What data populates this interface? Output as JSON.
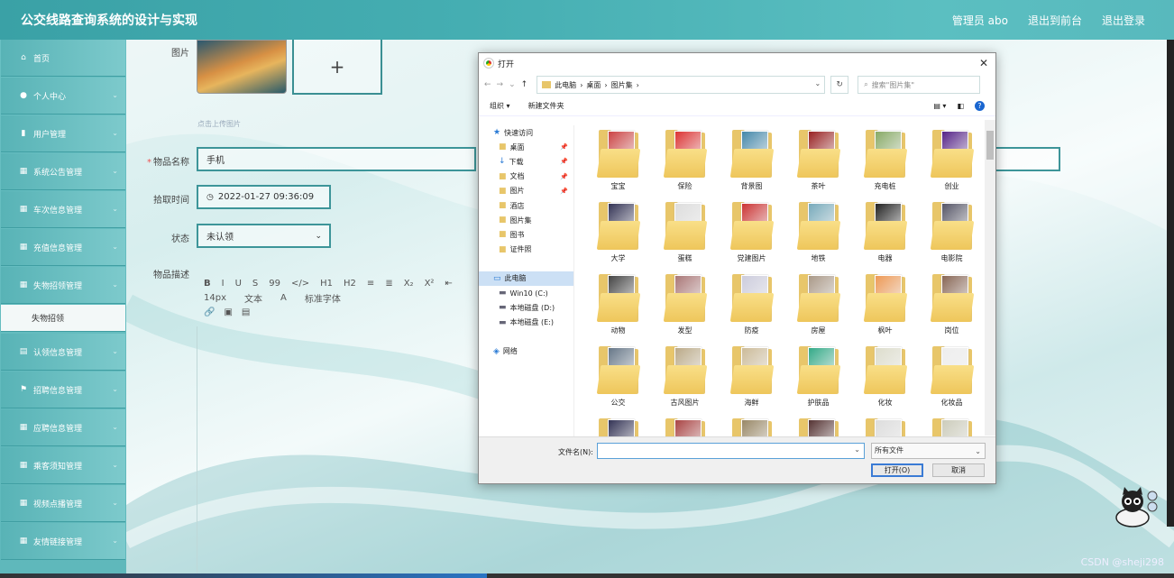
{
  "app": {
    "title": "公交线路查询系统的设计与实现",
    "user": "管理员 abo",
    "back_link": "退出到前台",
    "logout": "退出登录"
  },
  "sidebar": {
    "items": [
      {
        "label": "首页",
        "icon": "home-icon"
      },
      {
        "label": "个人中心",
        "icon": "user-icon"
      },
      {
        "label": "用户管理",
        "icon": "chart-icon"
      },
      {
        "label": "系统公告管理",
        "icon": "grid-icon"
      },
      {
        "label": "车次信息管理",
        "icon": "grid-icon"
      },
      {
        "label": "充值信息管理",
        "icon": "grid-icon"
      },
      {
        "label": "失物招领管理",
        "icon": "grid-icon"
      },
      {
        "label": "失物招领",
        "sub": true
      },
      {
        "label": "认领信息管理",
        "icon": "doc-icon"
      },
      {
        "label": "招聘信息管理",
        "icon": "flag-icon"
      },
      {
        "label": "应聘信息管理",
        "icon": "grid-icon"
      },
      {
        "label": "乘客须知管理",
        "icon": "grid-icon"
      },
      {
        "label": "视频点播管理",
        "icon": "grid-icon"
      },
      {
        "label": "友情链接管理",
        "icon": "grid-icon"
      }
    ]
  },
  "form": {
    "image_label": "图片",
    "upload_hint": "点击上传图片",
    "add_symbol": "+",
    "name_label": "物品名称",
    "name_value": "手机",
    "time_label": "拾取时间",
    "time_value": "2022-01-27 09:36:09",
    "status_label": "状态",
    "status_value": "未认领",
    "desc_label": "物品描述",
    "toolbar_row1": [
      "B",
      "I",
      "U",
      "S",
      "99",
      "</>",
      "H1",
      "H2",
      "≡",
      "≣",
      "X₂",
      "X²",
      "⇤"
    ],
    "toolbar_row2": [
      "14px",
      "文本",
      "A",
      "标准字体"
    ]
  },
  "dialog": {
    "title": "打开",
    "breadcrumb": [
      "此电脑",
      "桌面",
      "图片集"
    ],
    "search_placeholder": "搜索\"图片集\"",
    "organize": "组织 ▾",
    "new_folder": "新建文件夹",
    "nav": [
      {
        "label": "快速访问",
        "pin": false
      },
      {
        "label": "桌面",
        "pin": true
      },
      {
        "label": "下载",
        "pin": true
      },
      {
        "label": "文档",
        "pin": true
      },
      {
        "label": "图片",
        "pin": true
      },
      {
        "label": "酒店",
        "pin": false
      },
      {
        "label": "图片集",
        "pin": false
      },
      {
        "label": "图书",
        "pin": false
      },
      {
        "label": "证件照",
        "pin": false
      },
      {
        "label": "",
        "pin": false
      },
      {
        "label": "此电脑",
        "pin": false,
        "selected": true
      },
      {
        "label": "Win10 (C:)",
        "pin": false
      },
      {
        "label": "本地磁盘 (D:)",
        "pin": false
      },
      {
        "label": "本地磁盘 (E:)",
        "pin": false
      },
      {
        "label": "",
        "pin": false
      },
      {
        "label": "网络",
        "pin": false
      }
    ],
    "folders": [
      "宝宝",
      "保险",
      "背景图",
      "茶叶",
      "充电桩",
      "创业",
      "大学",
      "蛋糕",
      "党建图片",
      "地铁",
      "电器",
      "电影院",
      "动物",
      "发型",
      "防疫",
      "房屋",
      "枫叶",
      "岗位",
      "公交",
      "古风图片",
      "海鲜",
      "护肤品",
      "化妆",
      "化妆品",
      "",
      "",
      "",
      "",
      "",
      ""
    ],
    "filename_label": "文件名(N):",
    "filetype": "所有文件",
    "open_button": "打开(O)",
    "cancel_button": "取消"
  },
  "watermark": "CSDN @sheji298",
  "colors": {
    "header": "#45aeb2",
    "sidebar": "#5fb8bb",
    "field_border": "#3d9599",
    "dialog_selected": "#cce0f5"
  }
}
